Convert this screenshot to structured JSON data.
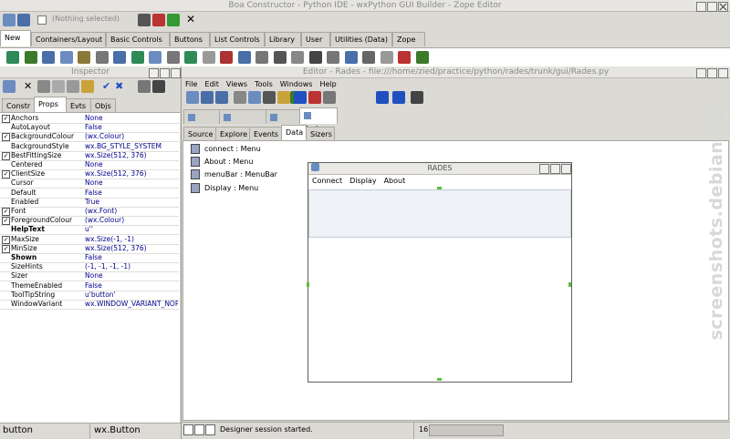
{
  "main_window": {
    "title": "Boa Constructor - Python IDE - wxPython GUI Builder - Zope Editor",
    "selection": "(Nothing selected)",
    "palette_tabs": [
      "New",
      "Containers/Layout",
      "Basic Controls",
      "Buttons",
      "List Controls",
      "Library",
      "User",
      "Utilities (Data)",
      "Zope"
    ]
  },
  "inspector": {
    "title": "Inspector",
    "tabs": [
      "Constr",
      "Props",
      "Evts",
      "Objs"
    ],
    "props": [
      {
        "name": "Anchors",
        "value": "None",
        "check": true
      },
      {
        "name": "AutoLayout",
        "value": "False"
      },
      {
        "name": "BackgroundColour",
        "value": "(wx.Colour)",
        "check": true
      },
      {
        "name": "BackgroundStyle",
        "value": "wx.BG_STYLE_SYSTEM"
      },
      {
        "name": "BestFittingSize",
        "value": "wx.Size(512, 376)",
        "check": true
      },
      {
        "name": "Centered",
        "value": "None"
      },
      {
        "name": "ClientSize",
        "value": "wx.Size(512, 376)",
        "check": true
      },
      {
        "name": "Cursor",
        "value": "None"
      },
      {
        "name": "Default",
        "value": "False"
      },
      {
        "name": "Enabled",
        "value": "True"
      },
      {
        "name": "Font",
        "value": "(wx.Font)",
        "check": true
      },
      {
        "name": "ForegroundColour",
        "value": "(wx.Colour)",
        "check": true
      },
      {
        "name": "HelpText",
        "value": "u''",
        "bold": true
      },
      {
        "name": "MaxSize",
        "value": "wx.Size(-1, -1)",
        "check": true
      },
      {
        "name": "MinSize",
        "value": "wx.Size(512, 376)",
        "check": true
      },
      {
        "name": "Shown",
        "value": "False",
        "bold": true
      },
      {
        "name": "SizeHints",
        "value": "(-1, -1, -1, -1)"
      },
      {
        "name": "Sizer",
        "value": "None"
      },
      {
        "name": "ThemeEnabled",
        "value": "False"
      },
      {
        "name": "ToolTipString",
        "value": "u'button'"
      },
      {
        "name": "WindowVariant",
        "value": "wx.WINDOW_VARIANT_NORMAL"
      }
    ],
    "status_name": "button",
    "status_class": "wx.Button"
  },
  "editor": {
    "title": "Editor - Rades - file:///home/zied/practice/python/rades/trunk/gui/Rades.py",
    "menu": [
      "File",
      "Edit",
      "Views",
      "Tools",
      "Windows",
      "Help"
    ],
    "top_tabs": [
      "Shell",
      "Explorer",
      "chat",
      "Rades"
    ],
    "sub_tabs": [
      "Source",
      "Explore",
      "Events",
      "Data",
      "Sizers"
    ],
    "data_items": [
      "connect : Menu",
      "About : Menu",
      "menuBar : MenuBar",
      "Display : Menu"
    ],
    "status_text": "Designer session started.",
    "status_num": "16"
  },
  "designer": {
    "title": "RADES",
    "menu": [
      "Connect",
      "Display",
      "About"
    ]
  },
  "watermark": "screenshots.debian.net"
}
